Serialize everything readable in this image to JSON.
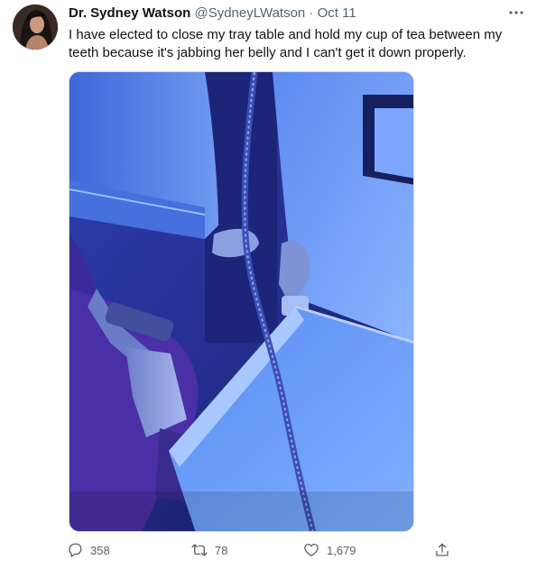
{
  "tweet": {
    "author_name": "Dr. Sydney Watson",
    "author_handle": "@SydneyLWatson",
    "separator": "·",
    "date": "Oct 11",
    "text": "I have elected to close my tray table and hold my cup of tea between my teeth because it's jabbing her belly and I can't get it down properly."
  },
  "actions": {
    "replies": "358",
    "retweets": "78",
    "likes": "1,679"
  },
  "icons": {
    "more": "more-horizontal-icon",
    "reply": "reply-icon",
    "retweet": "retweet-icon",
    "like": "heart-icon",
    "share": "share-icon"
  },
  "colors": {
    "text_primary": "#0f1419",
    "text_secondary": "#536471",
    "media_tint": "#3b4fd6"
  }
}
